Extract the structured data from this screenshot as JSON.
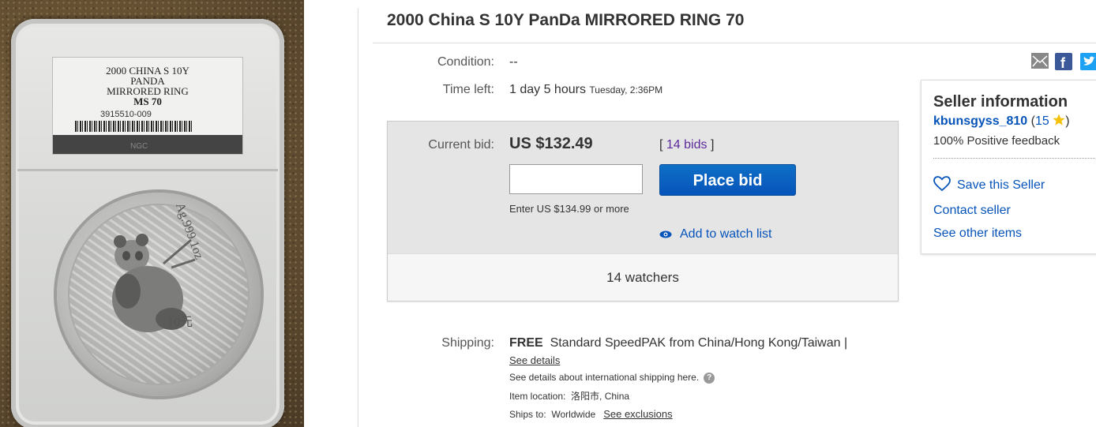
{
  "item": {
    "title": "2000 China S 10Y PanDa MIRRORED RING 70",
    "image_alt": "NGC slabbed silver panda coin"
  },
  "slab_label": {
    "line1": "2000 CHINA S 10Y",
    "line2": "PANDA",
    "line3": "MIRRORED RING",
    "grade": "MS 70",
    "cert": "3915510-009",
    "brand": "NGC"
  },
  "coin_text": {
    "ring": "Ag.999 1oz",
    "value": "10元"
  },
  "condition": {
    "label": "Condition:",
    "value": "--"
  },
  "time_left": {
    "label": "Time left:",
    "value": "1 day 5 hours",
    "end": "Tuesday, 2:36PM"
  },
  "bid": {
    "label": "Current bid:",
    "amount": "US $132.49",
    "bids_open": "[",
    "bids_link": "14 bids",
    "bids_close": "]",
    "input_placeholder": "",
    "place_bid": "Place bid",
    "hint": "Enter US $134.99 or more",
    "watch": "Add to watch list",
    "watchers": "14 watchers"
  },
  "shipping": {
    "label": "Shipping:",
    "free": "FREE",
    "service": "Standard SpeedPAK from China/Hong Kong/Taiwan |",
    "see_details": "See details",
    "intl": "See details about international shipping here.",
    "location_label": "Item location:",
    "location_value": "洛阳市, China",
    "ships_to_label": "Ships to:",
    "ships_to_value": "Worldwide",
    "exclusions": "See exclusions"
  },
  "seller": {
    "heading": "Seller information",
    "username": "kbunsgyss_810",
    "score_open": "(",
    "score": "15",
    "score_close": ")",
    "feedback": "100% Positive feedback",
    "save": "Save this Seller",
    "contact": "Contact seller",
    "other": "See other items"
  },
  "share": {
    "icons": [
      "email-icon",
      "facebook-icon",
      "twitter-icon"
    ]
  },
  "colors": {
    "link_blue": "#0654ba",
    "bids_purple": "#5d2a9c",
    "button_blue": "#0654ba"
  }
}
